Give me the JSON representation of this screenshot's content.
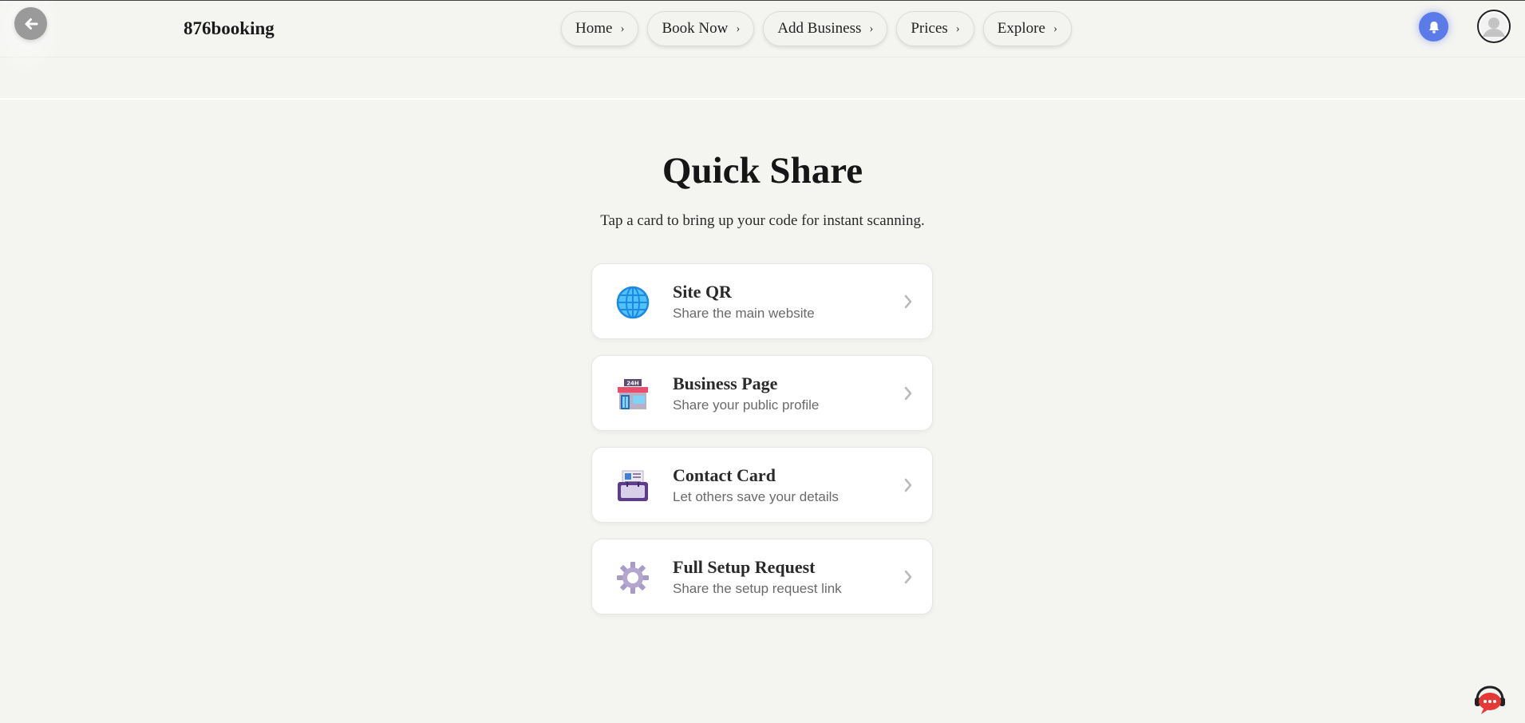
{
  "header": {
    "brand": "876booking",
    "nav": [
      {
        "label": "Home",
        "chevron": "›"
      },
      {
        "label": "Book Now",
        "chevron": "›"
      },
      {
        "label": "Add Business",
        "chevron": "›"
      },
      {
        "label": "Prices",
        "chevron": "›"
      },
      {
        "label": "Explore",
        "chevron": "›"
      }
    ],
    "icons": {
      "back": "arrow-left-icon",
      "notifications": "bell-icon",
      "profile": "user-avatar-icon"
    },
    "bell_color": "#5b7ce8"
  },
  "main": {
    "title": "Quick Share",
    "subtitle": "Tap a card to bring up your code for instant scanning.",
    "cards": [
      {
        "title": "Site QR",
        "description": "Share the main website",
        "icon": "globe-icon"
      },
      {
        "title": "Business Page",
        "description": "Share your public profile",
        "icon": "storefront-24h-icon"
      },
      {
        "title": "Contact Card",
        "description": "Let others save your details",
        "icon": "id-card-icon"
      },
      {
        "title": "Full Setup Request",
        "description": "Share the setup request link",
        "icon": "gear-icon"
      }
    ]
  },
  "support": {
    "icon": "chat-support-icon",
    "color": "#e53935"
  }
}
